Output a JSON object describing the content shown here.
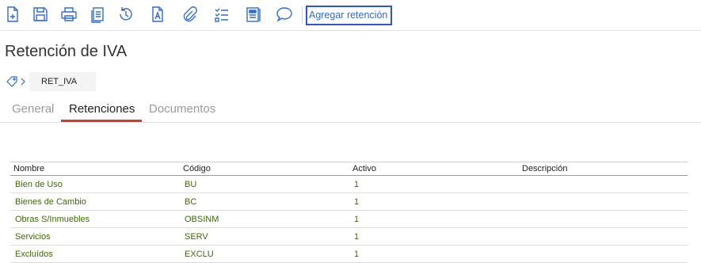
{
  "toolbar": {
    "icons": [
      "new-document-icon",
      "save-icon",
      "print-icon",
      "copy-icon",
      "history-icon",
      "text-document-icon",
      "attachment-icon",
      "checklist-icon",
      "report-icon",
      "comment-icon"
    ],
    "add_label": "Agregar retención",
    "accent_color": "#2f6bd1",
    "icon_color": "#2f6bd1"
  },
  "page": {
    "title": "Retención de IVA",
    "code": "RET_IVA"
  },
  "tabs": [
    {
      "label": "General",
      "active": false
    },
    {
      "label": "Retenciones",
      "active": true
    },
    {
      "label": "Documentos",
      "active": false
    }
  ],
  "table": {
    "columns": [
      "Nombre",
      "Código",
      "Activo",
      "Descripción"
    ],
    "rows": [
      {
        "nombre": "Bien de Uso",
        "codigo": "BU",
        "activo": "1",
        "descripcion": ""
      },
      {
        "nombre": "Bienes de Cambio",
        "codigo": "BC",
        "activo": "1",
        "descripcion": ""
      },
      {
        "nombre": "Obras S/Inmuebles",
        "codigo": "OBSINM",
        "activo": "1",
        "descripcion": ""
      },
      {
        "nombre": "Servicios",
        "codigo": "SERV",
        "activo": "1",
        "descripcion": ""
      },
      {
        "nombre": "Excluídos",
        "codigo": "EXCLU",
        "activo": "1",
        "descripcion": ""
      }
    ],
    "row_text_color": "#3d6b00",
    "active_tab_color": "#d23b2c"
  }
}
